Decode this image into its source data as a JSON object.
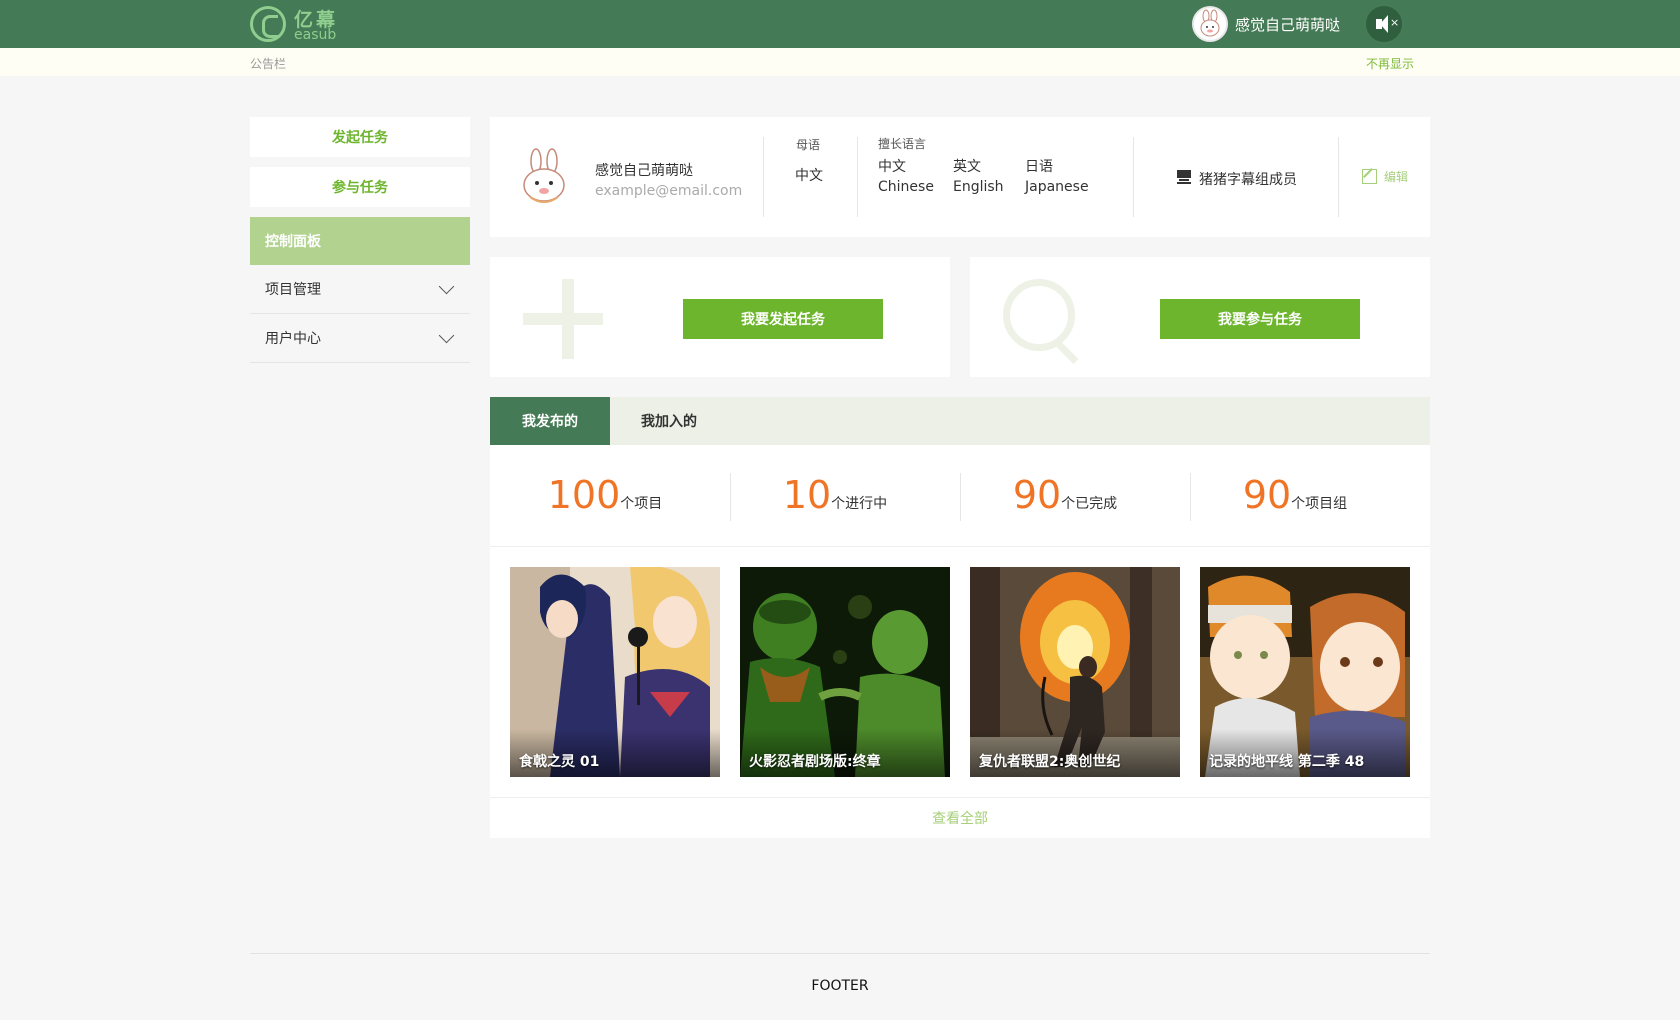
{
  "header": {
    "logo_cn": "亿幕",
    "logo_en": "easub",
    "username": "感觉自己萌萌哒",
    "sound_icon": "speaker-mute-icon"
  },
  "notice": {
    "label": "公告栏",
    "dismiss": "不再显示"
  },
  "sidebar": {
    "start_task": "发起任务",
    "join_task": "参与任务",
    "dashboard": "控制面板",
    "items": [
      {
        "label": "项目管理"
      },
      {
        "label": "用户中心"
      }
    ]
  },
  "profile": {
    "name": "感觉自己萌萌哒",
    "email": "example@email.com",
    "native_label": "母语",
    "native_lang": "中文",
    "skilled_label": "擅长语言",
    "langs": [
      {
        "cn": "中文",
        "en": "Chinese"
      },
      {
        "cn": "英文",
        "en": "English"
      },
      {
        "cn": "日语",
        "en": "Japanese"
      }
    ],
    "team": "猪猪字幕组成员",
    "edit": "编辑"
  },
  "actions": {
    "start": "我要发起任务",
    "join": "我要参与任务"
  },
  "tabs": [
    {
      "label": "我发布的",
      "active": true
    },
    {
      "label": "我加入的",
      "active": false
    }
  ],
  "stats": [
    {
      "num": "100",
      "label": "个项目"
    },
    {
      "num": "10",
      "label": "个进行中"
    },
    {
      "num": "90",
      "label": "个已完成"
    },
    {
      "num": "90",
      "label": "个项目组"
    }
  ],
  "cards": [
    {
      "title": "食戟之灵 01"
    },
    {
      "title": "火影忍者剧场版:终章"
    },
    {
      "title": "复仇者联盟2:奥创世纪"
    },
    {
      "title": "记录的地平线 第二季 48"
    }
  ],
  "view_all": "查看全部",
  "footer": "FOOTER",
  "colors": {
    "brand_green": "#447a55",
    "accent_green": "#6db52d",
    "orange": "#f07426"
  }
}
